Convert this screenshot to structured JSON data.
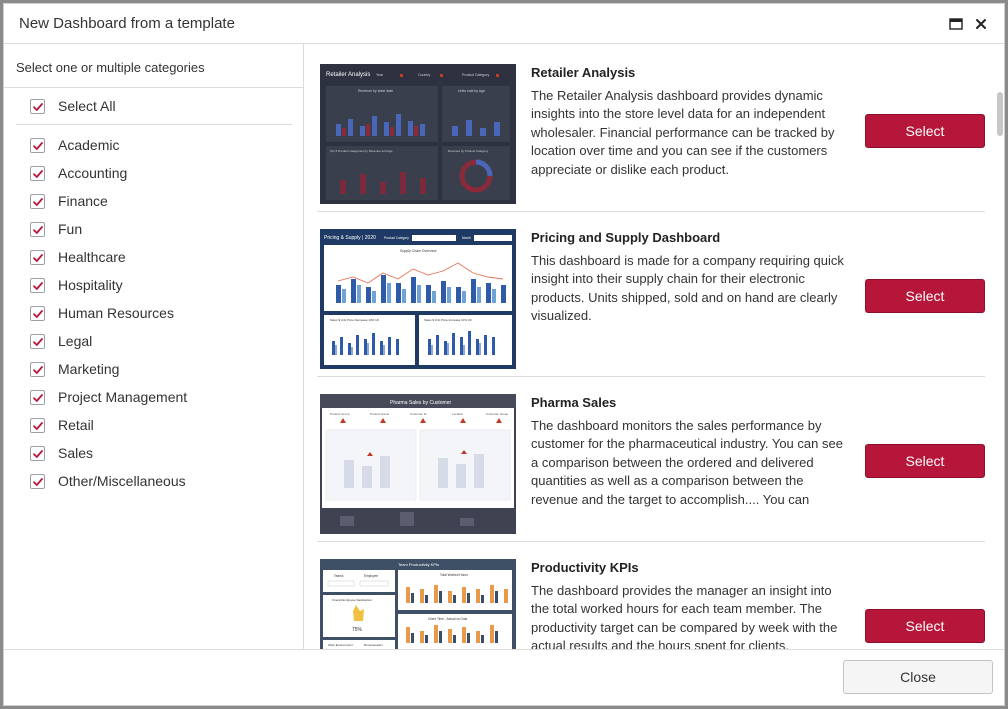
{
  "dialog": {
    "title": "New Dashboard from a template",
    "maximize_icon": "maximize-icon",
    "close_icon": "close-icon"
  },
  "sidebar": {
    "heading": "Select one or multiple categories",
    "select_all": {
      "label": "Select All",
      "checked": true
    },
    "categories": [
      {
        "label": "Academic",
        "checked": true
      },
      {
        "label": "Accounting",
        "checked": true
      },
      {
        "label": "Finance",
        "checked": true
      },
      {
        "label": "Fun",
        "checked": true
      },
      {
        "label": "Healthcare",
        "checked": true
      },
      {
        "label": "Hospitality",
        "checked": true
      },
      {
        "label": "Human Resources",
        "checked": true
      },
      {
        "label": "Legal",
        "checked": true
      },
      {
        "label": "Marketing",
        "checked": true
      },
      {
        "label": "Project Management",
        "checked": true
      },
      {
        "label": "Retail",
        "checked": true
      },
      {
        "label": "Sales",
        "checked": true
      },
      {
        "label": "Other/Miscellaneous",
        "checked": true
      }
    ]
  },
  "templates": [
    {
      "title": "Retailer Analysis",
      "description": "The Retailer Analysis dashboard provides dynamic insights into the store level data for an independent wholesaler. Financial performance can be tracked by location over time and you can see if the customers appreciate or dislike each product.",
      "button_label": "Select"
    },
    {
      "title": "Pricing and Supply Dashboard",
      "description": "This dashboard is made for a company requiring quick insight into their supply chain for their electronic products. Units shipped, sold and on hand are clearly visualized.",
      "button_label": "Select"
    },
    {
      "title": "Pharma Sales",
      "description": "The dashboard monitors the sales performance by customer for the pharmaceutical industry. You can see a comparison between the ordered and delivered quantities as well as a comparison between the revenue and the target to accomplish.... You can interact with the dashboard and choose",
      "button_label": "Select"
    },
    {
      "title": "Productivity KPIs",
      "description": "The dashboard provides the manager an insight into the total worked hours for each team member. The productivity target can be compared by week with the actual results and the hours spent for clients.",
      "button_label": "Select"
    }
  ],
  "thumbnails": {
    "retailer": {
      "header": "Retailer Analysis",
      "filters": [
        "Year",
        "Country",
        "Product Category"
      ],
      "panels": [
        "Revenue by state date",
        "Units sold by Age",
        "Top 5 Product Categories by Revenue and Age",
        "Revenue by Product Category"
      ]
    },
    "pricing": {
      "header": "Pricing & Supply | 2020",
      "filters": [
        "Product Category",
        "Month"
      ],
      "panels": [
        "Supply Chain Overview",
        "Sales $ Unit Price Decrease 10% Ult",
        "Sales $ Unit Price Increase 10% Ult"
      ]
    },
    "pharma": {
      "header": "Pharma Sales by Customer",
      "filters": [
        "Product Group",
        "Product Name",
        "Customer Id",
        "Location",
        "Customer Group"
      ]
    },
    "productivity": {
      "header": "Team Productivity KPIs",
      "filters": [
        "Teams",
        "Employee"
      ],
      "panels": [
        "Total Worked Hours",
        "Overall Employee Satisfaction",
        "Client Time - Actual vs Goal",
        "Work Environment",
        "Remuneration"
      ],
      "satisfaction_value": "75%"
    }
  },
  "footer": {
    "close_label": "Close"
  },
  "colors": {
    "accent": "#b5163a",
    "checkmark": "#b5163a",
    "thumb_dark": "#2e3240",
    "thumb_navy": "#1f3a64"
  }
}
